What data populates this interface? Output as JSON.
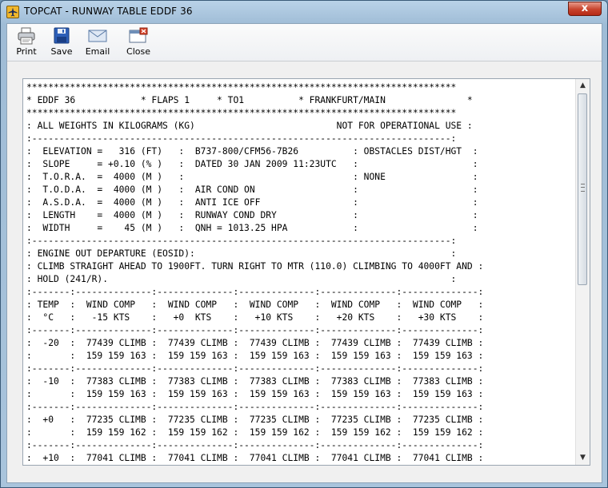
{
  "window": {
    "title": "TOPCAT - RUNWAY TABLE EDDF 36",
    "close_label": "x"
  },
  "toolbar": {
    "print_label": "Print",
    "save_label": "Save",
    "email_label": "Email",
    "close_label": "Close"
  },
  "report": {
    "lines": [
      "*******************************************************************************",
      "* EDDF 36            * FLAPS 1     * TO1          * FRANKFURT/MAIN               *",
      "*******************************************************************************",
      ": ALL WEIGHTS IN KILOGRAMS (KG)                          NOT FOR OPERATIONAL USE :",
      ":-----------------------------------------------------------------------------:",
      ":  ELEVATION =   316 (FT)   :  B737-800/CFM56-7B26          : OBSTACLES DIST/HGT  :",
      ":  SLOPE     = +0.10 (% )   :  DATED 30 JAN 2009 11:23UTC   :                     :",
      ":  T.O.R.A.  =  4000 (M )   :                               : NONE                :",
      ":  T.O.D.A.  =  4000 (M )   :  AIR COND ON                  :                     :",
      ":  A.S.D.A.  =  4000 (M )   :  ANTI ICE OFF                 :                     :",
      ":  LENGTH    =  4000 (M )   :  RUNWAY COND DRY              :                     :",
      ":  WIDTH     =    45 (M )   :  QNH = 1013.25 HPA            :                     :",
      ":-----------------------------------------------------------------------------:",
      ": ENGINE OUT DEPARTURE (EOSID):                                               :",
      ": CLIMB STRAIGHT AHEAD TO 1900FT. TURN RIGHT TO MTR (110.0) CLIMBING TO 4000FT AND :",
      ": HOLD (241/R).                                                               :",
      ":-------:--------------:--------------:--------------:--------------:--------------:",
      ": TEMP  :  WIND COMP   :  WIND COMP   :  WIND COMP   :  WIND COMP   :  WIND COMP   :",
      ":  °C   :   -15 KTS    :   +0  KTS    :   +10 KTS    :   +20 KTS    :   +30 KTS    :",
      ":-------:--------------:--------------:--------------:--------------:--------------:",
      ":  -20  :  77439 CLIMB :  77439 CLIMB :  77439 CLIMB :  77439 CLIMB :  77439 CLIMB :",
      ":       :  159 159 163 :  159 159 163 :  159 159 163 :  159 159 163 :  159 159 163 :",
      ":-------:--------------:--------------:--------------:--------------:--------------:",
      ":  -10  :  77383 CLIMB :  77383 CLIMB :  77383 CLIMB :  77383 CLIMB :  77383 CLIMB :",
      ":       :  159 159 163 :  159 159 163 :  159 159 163 :  159 159 163 :  159 159 163 :",
      ":-------:--------------:--------------:--------------:--------------:--------------:",
      ":  +0   :  77235 CLIMB :  77235 CLIMB :  77235 CLIMB :  77235 CLIMB :  77235 CLIMB :",
      ":       :  159 159 162 :  159 159 162 :  159 159 162 :  159 159 162 :  159 159 162 :",
      ":-------:--------------:--------------:--------------:--------------:--------------:",
      ":  +10  :  77041 CLIMB :  77041 CLIMB :  77041 CLIMB :  77041 CLIMB :  77041 CLIMB :"
    ]
  }
}
